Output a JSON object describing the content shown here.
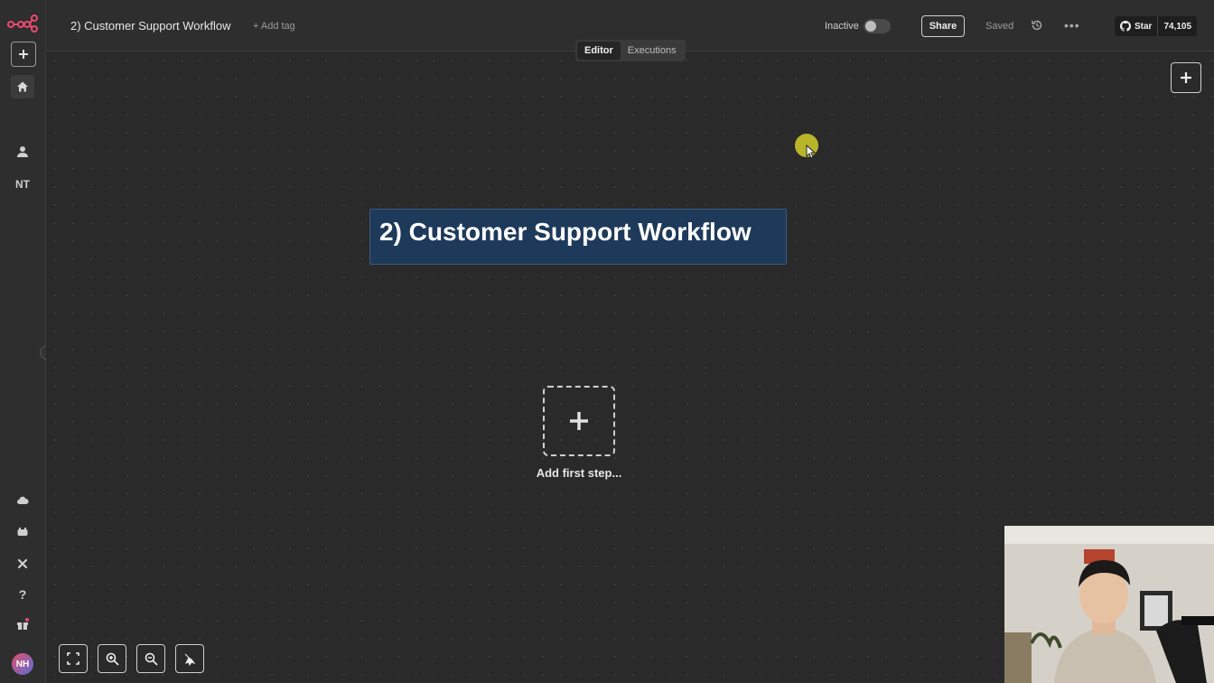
{
  "header": {
    "workflow_title": "2) Customer Support Workflow",
    "add_tag": "+ Add tag",
    "active_toggle_label": "Inactive",
    "share_label": "Share",
    "save_status": "Saved",
    "github_star_label": "Star",
    "github_star_count": "74,105"
  },
  "tabs": [
    {
      "label": "Editor",
      "active": true
    },
    {
      "label": "Executions",
      "active": false
    }
  ],
  "sidebar": {
    "user_initials": "NT",
    "avatar_initials": "NH"
  },
  "canvas": {
    "sticky_note_text": "2) Customer Support Workflow",
    "add_first_step_label": "Add first step..."
  },
  "colors": {
    "canvas_bg": "#2a2a2a",
    "sticky_bg": "#1e3a5a",
    "logo_accent": "#ea4b71",
    "cursor_highlight": "#c9c42a"
  }
}
